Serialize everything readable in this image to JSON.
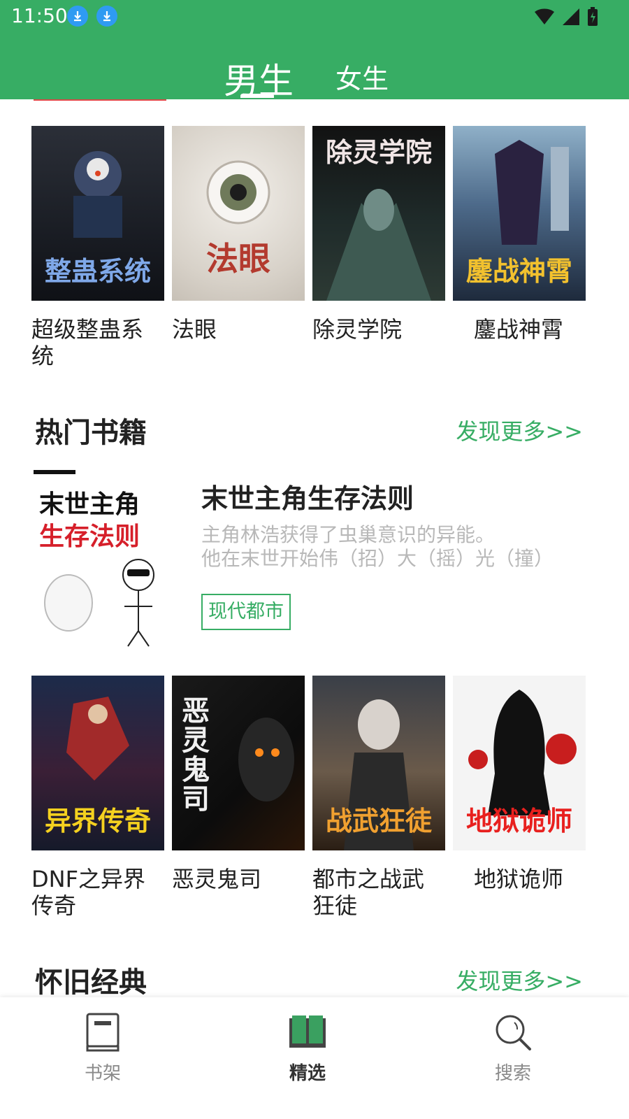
{
  "status_bar": {
    "time": "11:50"
  },
  "tabs": {
    "male": "男生",
    "female": "女生",
    "selected": "男生"
  },
  "books_row1": [
    {
      "title": "超级整蛊系统",
      "cover_text": "整蛊系统"
    },
    {
      "title": "法眼",
      "cover_text": "法眼"
    },
    {
      "title": "除灵学院",
      "cover_text": "除灵学院"
    },
    {
      "title": "鏖战神霄",
      "cover_text": "鏖战神霄"
    }
  ],
  "hot_section": {
    "title": "热门书籍",
    "more": "发现更多>>"
  },
  "featured": {
    "title": "末世主角生存法则",
    "desc_line1": "主角林浩获得了虫巢意识的异能。",
    "desc_line2": "他在末世开始伟（招）大（摇）光（撞）",
    "tag": "现代都市",
    "cover_line1": "末世主角",
    "cover_line2": "生存法则"
  },
  "books_row2": [
    {
      "title": "DNF之异界传奇",
      "cover_text": "异界传奇"
    },
    {
      "title": "恶灵鬼司",
      "cover_text": "恶灵鬼司"
    },
    {
      "title": "都市之战武狂徒",
      "cover_text": "战武狂徒"
    },
    {
      "title": "地狱诡师",
      "cover_text": "地狱诡师"
    }
  ],
  "classic_section": {
    "title": "怀旧经典",
    "more": "发现更多>>"
  },
  "bottom_nav": [
    {
      "label": "书架",
      "icon": "bookshelf-icon"
    },
    {
      "label": "精选",
      "icon": "open-book-icon",
      "active": true
    },
    {
      "label": "搜索",
      "icon": "search-icon"
    }
  ],
  "colors": {
    "brand_green": "#37ad64",
    "download_blue": "#2f9bf2"
  }
}
